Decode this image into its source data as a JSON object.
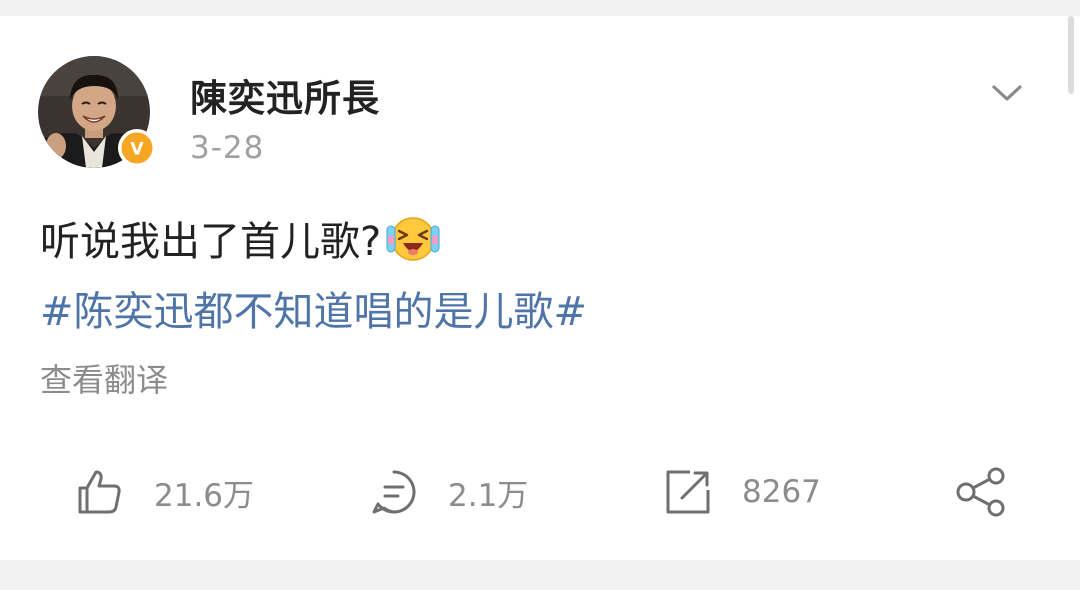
{
  "post": {
    "author": "陳奕迅所長",
    "time": "3-28",
    "text": "听说我出了首儿歌?",
    "hashtag": "#陈奕迅都不知道唱的是儿歌#",
    "translate_label": "查看翻译",
    "verified_badge": "V"
  },
  "actions": {
    "likes": "21.6万",
    "comments": "2.1万",
    "reposts": "8267"
  },
  "icons": {
    "more": "chevron-down-icon",
    "like": "thumbs-up-icon",
    "comment": "comment-bubble-icon",
    "repost": "repost-icon",
    "share": "share-icon",
    "emoji": "laugh-crying-emoji-icon"
  },
  "colors": {
    "hashtag": "#4f75a8",
    "verified": "#f5a623",
    "muted_text": "#8c8c8c",
    "icon": "#6f6f6f"
  }
}
